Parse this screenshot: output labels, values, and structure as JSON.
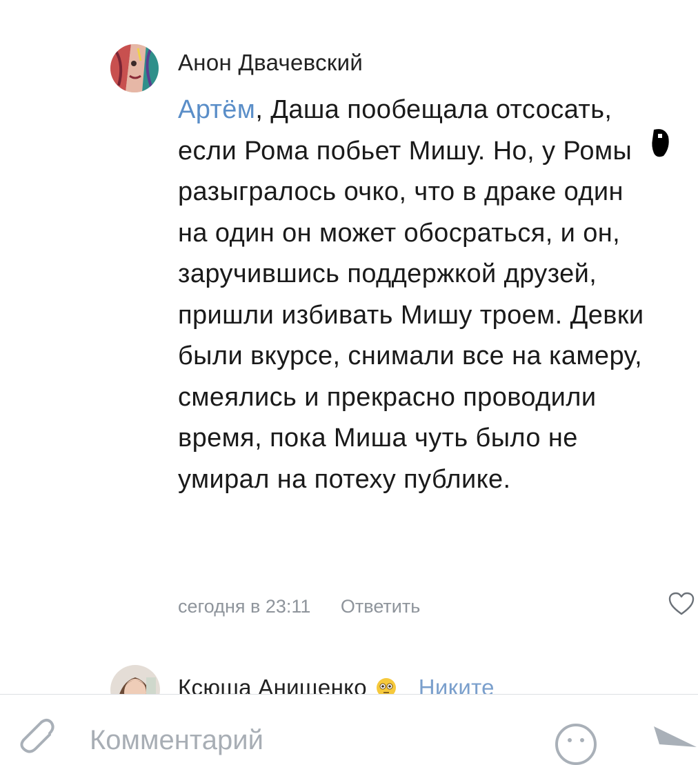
{
  "comments": [
    {
      "author": "Анон Двачевский",
      "reply_to": "Артём",
      "text": ", Даша пообещала отсосать, если Рома побьет Мишу. Но, у Ромы разыгралось очко, что в драке один на один он может обосраться, и он, заручившись поддержкой друзей, пришли избивать Мишу троем. Девки были вкурсе, снимали все на камеру, смеялись и прекрасно проводили время, пока Миша чуть было не умирал на потеху публике.",
      "timestamp": "сегодня в 23:11",
      "reply_label": "Ответить",
      "like_icon": "heart-outline-icon"
    },
    {
      "author": "Ксюша Анищенко",
      "emoji": "flushed-face",
      "reply_to": "Никите"
    }
  ],
  "composer": {
    "placeholder": "Комментарий",
    "attach_icon": "paperclip-icon",
    "emoji_icon": "smile-icon",
    "send_icon": "send-icon"
  },
  "colors": {
    "link": "#5a8ec8",
    "meta": "#8e949b",
    "text": "#1a1a1a"
  }
}
